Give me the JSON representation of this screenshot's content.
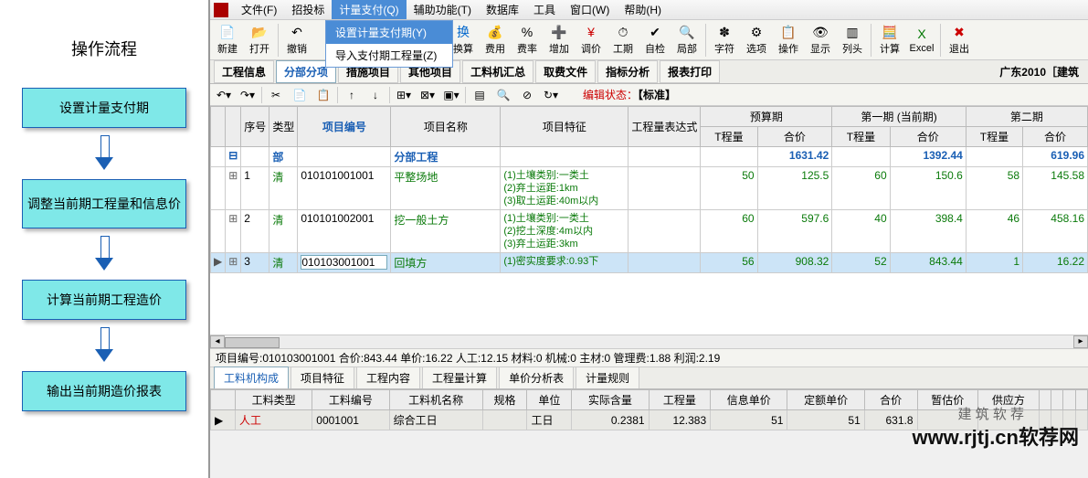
{
  "flow": {
    "title": "操作流程",
    "steps": [
      "设置计量支付期",
      "调整当前期工程量和信息价",
      "计算当前期工程造价",
      "输出当前期造价报表"
    ]
  },
  "menubar": {
    "items": [
      "文件(F)",
      "招投标",
      "计量支付(Q)",
      "辅助功能(T)",
      "数据库",
      "工具",
      "窗口(W)",
      "帮助(H)"
    ]
  },
  "dropdown": {
    "items": [
      "设置计量支付期(Y)",
      "导入支付期工程量(Z)"
    ]
  },
  "toolbar": {
    "buttons": [
      "新建",
      "打开",
      "撤销",
      "",
      "",
      "换算",
      "费用",
      "费率",
      "增加",
      "调价",
      "工期",
      "自检",
      "局部",
      "字符",
      "选项",
      "操作",
      "显示",
      "列头",
      "计算",
      "Excel",
      "退出"
    ]
  },
  "tabs": {
    "items": [
      "工程信息",
      "分部分项",
      "措施项目",
      "其他项目",
      "工料机汇总",
      "取费文件",
      "指标分析",
      "报表打印"
    ],
    "active": 1,
    "right": "广东2010［建筑"
  },
  "edit_status": {
    "label": "编辑状态：",
    "value": "【标准】"
  },
  "grid": {
    "headers": [
      "",
      "",
      "序号",
      "类型",
      "项目编号",
      "项目名称",
      "项目特征",
      "工程量表达式"
    ],
    "period_headers": [
      {
        "title": "预算期",
        "cols": [
          "T程量",
          "合价"
        ]
      },
      {
        "title": "第一期 (当前期)",
        "cols": [
          "T程量",
          "合价"
        ]
      },
      {
        "title": "第二期",
        "cols": [
          "T程量",
          "合价"
        ]
      }
    ],
    "rows": [
      {
        "type": "header",
        "seq": "",
        "cat": "部",
        "code": "",
        "name": "分部工程",
        "feat": "",
        "expr": "",
        "p0": [
          "",
          "1631.42"
        ],
        "p1": [
          "",
          "1392.44"
        ],
        "p2": [
          "",
          "619.96"
        ],
        "blue": true,
        "expand": "⊟"
      },
      {
        "type": "data",
        "seq": "1",
        "cat": "清",
        "code": "010101001001",
        "name": "平整场地",
        "feat": "(1)土壤类别:一类土\n(2)弃土运距:1km\n(3)取土运距:40m以内",
        "expr": "",
        "p0": [
          "50",
          "125.5"
        ],
        "p1": [
          "60",
          "150.6"
        ],
        "p2": [
          "58",
          "145.58"
        ],
        "expand": "⊞"
      },
      {
        "type": "data",
        "seq": "2",
        "cat": "清",
        "code": "010101002001",
        "name": "挖一般土方",
        "feat": "(1)土壤类别:一类土\n(2)挖土深度:4m以内\n(3)弃土运距:3km",
        "expr": "",
        "p0": [
          "60",
          "597.6"
        ],
        "p1": [
          "40",
          "398.4"
        ],
        "p2": [
          "46",
          "458.16"
        ],
        "expand": "⊞"
      },
      {
        "type": "data",
        "seq": "3",
        "cat": "清",
        "code": "010103001001",
        "name": "回填方",
        "feat": "(1)密实度要求:0.93下",
        "expr": "",
        "p0": [
          "56",
          "908.32"
        ],
        "p1": [
          "52",
          "843.44"
        ],
        "p2": [
          "1",
          "16.22"
        ],
        "expand": "⊞",
        "sel": true,
        "arrow": "▶"
      }
    ]
  },
  "info_line": "项目编号:010103001001  合价:843.44  单价:16.22  人工:12.15  材料:0  机械:0  主材:0  管理费:1.88  利润:2.19",
  "sub_tabs": {
    "items": [
      "工料机构成",
      "项目特征",
      "工程内容",
      "工程量计算",
      "单价分析表",
      "计量规则"
    ],
    "active": 0
  },
  "sub_grid": {
    "headers": [
      "",
      "工料类型",
      "工料编号",
      "工料机名称",
      "规格",
      "单位",
      "实际含量",
      "工程量",
      "信息单价",
      "定额单价",
      "合价",
      "暂估价",
      "供应方",
      "",
      "",
      "",
      ""
    ],
    "row": {
      "arrow": "▶",
      "type": "人工",
      "code": "0001001",
      "name": "综合工日",
      "spec": "",
      "unit": "工日",
      "qty": "0.2381",
      "amt": "12.383",
      "info": "51",
      "de": "51",
      "total": "631.8"
    }
  },
  "watermark": "www.rjtj.cn软荐网",
  "watermark_sm": "建 筑 软 荐"
}
